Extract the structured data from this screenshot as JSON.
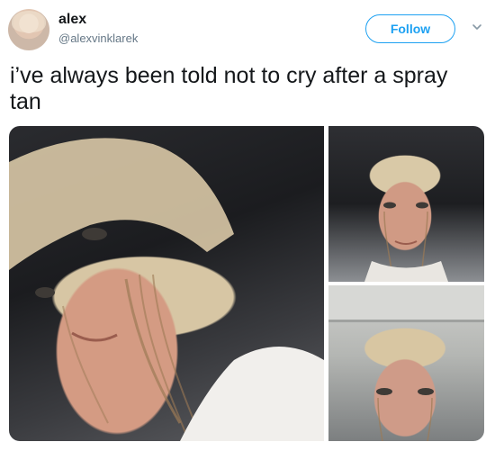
{
  "tweet": {
    "author": {
      "name": "alex",
      "handle": "@alexvinklarek"
    },
    "follow_label": "Follow",
    "text": "i’ve always been told not to cry after a spray tan"
  },
  "colors": {
    "accent": "#1da1f2",
    "text_primary": "#14171a",
    "text_secondary": "#657786"
  },
  "icons": {
    "more": "chevron-down-icon"
  },
  "media": {
    "photo_count": 3
  }
}
